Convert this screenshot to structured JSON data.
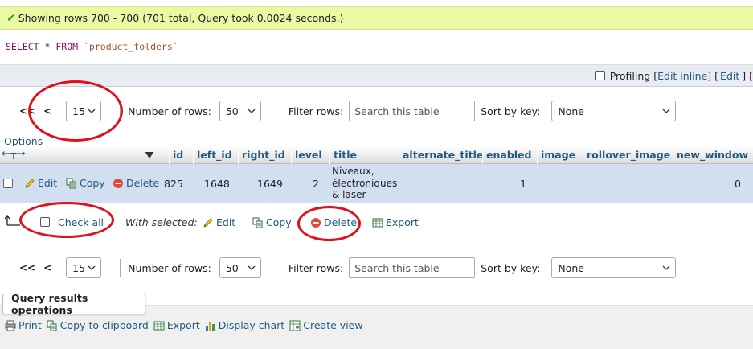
{
  "message": {
    "text": "Showing rows 700 - 700 (701 total, Query took 0.0024 seconds.)"
  },
  "sql": {
    "select": "SELECT",
    "star": "*",
    "from": "FROM",
    "table": "`product_folders`"
  },
  "profiling": {
    "label": "Profiling",
    "bracket_open": "[",
    "edit_inline": "Edit inline",
    "bracket_close": "]",
    "edit": "Edit",
    "trailing": "] ["
  },
  "nav_top": {
    "first": "<<",
    "prev": "<",
    "page": "15",
    "rows_label": "Number of rows:",
    "rows_value": "50",
    "filter_label": "Filter rows:",
    "filter_placeholder": "Search this table",
    "sort_label": "Sort by key:",
    "sort_value": "None"
  },
  "nav_bottom": {
    "first": "<<",
    "prev": "<",
    "page": "15",
    "rows_label": "Number of rows:",
    "rows_value": "50",
    "filter_label": "Filter rows:",
    "filter_placeholder": "Search this table",
    "sort_label": "Sort by key:",
    "sort_value": "None"
  },
  "options_label": "Options",
  "columns": [
    "id",
    "left_id",
    "right_id",
    "level",
    "title",
    "alternate_title",
    "enabled",
    "image",
    "rollover_image",
    "new_window"
  ],
  "row": {
    "edit": "Edit",
    "copy": "Copy",
    "delete": "Delete",
    "id": "825",
    "left_id": "1648",
    "right_id": "1649",
    "level": "2",
    "title_lines": [
      "Niveaux,",
      "électroniques",
      "& laser"
    ],
    "enabled": "1",
    "new_window": "0"
  },
  "bulk": {
    "check_all": "Check all",
    "with_selected": "With selected:",
    "edit": "Edit",
    "copy": "Copy",
    "delete": "Delete",
    "export": "Export"
  },
  "query_ops": {
    "title": "Query results operations",
    "print": "Print",
    "copy_clipboard": "Copy to clipboard",
    "export": "Export",
    "display_chart": "Display chart",
    "create_view": "Create view"
  },
  "colors": {
    "link": "#235a81",
    "success_bg": "#ebf8a4",
    "annotation": "#e0101a",
    "row_bg": "#d2dff0"
  }
}
